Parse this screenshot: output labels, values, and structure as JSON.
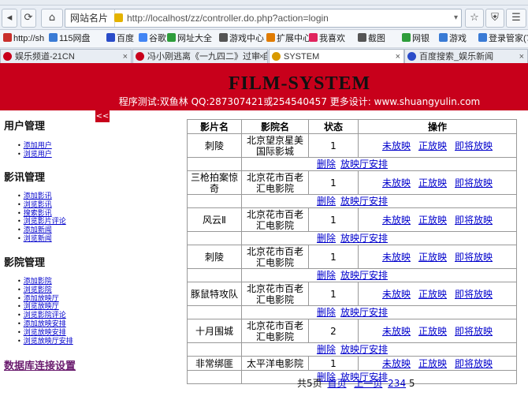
{
  "browser": {
    "site_menu_label": "网站名片",
    "url": "http://localhost/zz/controller.do.php?action=login",
    "bookmarks": [
      {
        "label": "http://sh",
        "color": "#c9302c"
      },
      {
        "label": "115网盘",
        "color": "#3a7bd5"
      },
      {
        "label": "百度",
        "color": "#2a4cc9"
      },
      {
        "label": "谷歌",
        "color": "#4285f4"
      },
      {
        "label": "网址大全",
        "color": "#2e9d3b"
      },
      {
        "label": "游戏中心",
        "color": "#555555"
      },
      {
        "label": "扩展中心",
        "color": "#e07b00"
      },
      {
        "label": "我喜欢",
        "color": "#e0245e"
      },
      {
        "label": "截图",
        "color": "#555555"
      },
      {
        "label": "网银",
        "color": "#2e9d3b"
      },
      {
        "label": "游戏",
        "color": "#3a7bd5"
      },
      {
        "label": "登录管家(7)",
        "color": "#3a7bd5"
      }
    ],
    "tabs": [
      {
        "label": "娱乐频道-21CN",
        "icon_color": "#c8001b"
      },
      {
        "label": "冯小刚逃离《一九四二》过审 自…",
        "icon_color": "#c8001b"
      },
      {
        "label": "SYSTEM",
        "icon_color": "#d99a00"
      },
      {
        "label": "百度搜索_娱乐新闻",
        "icon_color": "#2a4cc9"
      }
    ]
  },
  "header": {
    "title": "FILM-SYSTEM",
    "subtitle": "程序测试:双鱼林 QQ:287307421或254540457 更多设计: www.shuangyulin.com",
    "bg_color": "#c8001b"
  },
  "sidebar": {
    "toggle_label": "<<",
    "sections": [
      {
        "title": "用户管理",
        "items": [
          "添加用户",
          "浏览用户"
        ]
      },
      {
        "title": "影讯管理",
        "items": [
          "添加影讯",
          "浏览影讯",
          "搜索影讯",
          "浏览影片评论",
          "添加新闻",
          "浏览新闻"
        ]
      },
      {
        "title": "影院管理",
        "items": [
          "添加影院",
          "浏览影院",
          "添加放映厅",
          "浏览放映厅",
          "浏览影院评论",
          "添加放映安排",
          "浏览放映安排",
          "浏览放映厅安排"
        ]
      }
    ],
    "db_link": "数据库连接设置"
  },
  "table": {
    "headers": [
      "影片名",
      "影院名",
      "状态",
      "操作"
    ],
    "actions": [
      "未放映",
      "正放映",
      "即将放映"
    ],
    "sub_actions": [
      "删除",
      "放映厅安排"
    ],
    "rows": [
      {
        "film": "刺陵",
        "cinema": "北京望京星美国际影城",
        "status": "1"
      },
      {
        "film": "三枪拍案惊奇",
        "cinema": "北京花市百老汇电影院",
        "status": "1"
      },
      {
        "film": "风云Ⅱ",
        "cinema": "北京花市百老汇电影院",
        "status": "1"
      },
      {
        "film": "刺陵",
        "cinema": "北京花市百老汇电影院",
        "status": "1"
      },
      {
        "film": "豚鼠特攻队",
        "cinema": "北京花市百老汇电影院",
        "status": "1"
      },
      {
        "film": "十月围城",
        "cinema": "北京花市百老汇电影院",
        "status": "2"
      },
      {
        "film": "非常绑匪",
        "cinema": "太平洋电影院",
        "status": "1"
      }
    ]
  },
  "pager": {
    "total": "共5页",
    "first": "首页",
    "prev": "上一页",
    "pages": [
      "2",
      "3",
      "4"
    ],
    "current": "5"
  }
}
